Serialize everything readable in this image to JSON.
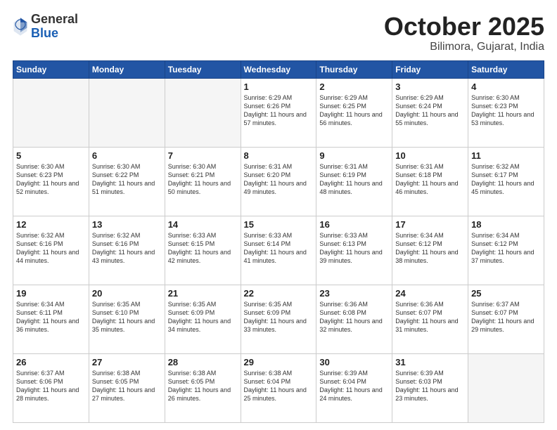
{
  "header": {
    "logo_general": "General",
    "logo_blue": "Blue",
    "month": "October 2025",
    "location": "Bilimora, Gujarat, India"
  },
  "weekdays": [
    "Sunday",
    "Monday",
    "Tuesday",
    "Wednesday",
    "Thursday",
    "Friday",
    "Saturday"
  ],
  "weeks": [
    [
      {
        "day": "",
        "info": ""
      },
      {
        "day": "",
        "info": ""
      },
      {
        "day": "",
        "info": ""
      },
      {
        "day": "1",
        "info": "Sunrise: 6:29 AM\nSunset: 6:26 PM\nDaylight: 11 hours\nand 57 minutes."
      },
      {
        "day": "2",
        "info": "Sunrise: 6:29 AM\nSunset: 6:25 PM\nDaylight: 11 hours\nand 56 minutes."
      },
      {
        "day": "3",
        "info": "Sunrise: 6:29 AM\nSunset: 6:24 PM\nDaylight: 11 hours\nand 55 minutes."
      },
      {
        "day": "4",
        "info": "Sunrise: 6:30 AM\nSunset: 6:23 PM\nDaylight: 11 hours\nand 53 minutes."
      }
    ],
    [
      {
        "day": "5",
        "info": "Sunrise: 6:30 AM\nSunset: 6:23 PM\nDaylight: 11 hours\nand 52 minutes."
      },
      {
        "day": "6",
        "info": "Sunrise: 6:30 AM\nSunset: 6:22 PM\nDaylight: 11 hours\nand 51 minutes."
      },
      {
        "day": "7",
        "info": "Sunrise: 6:30 AM\nSunset: 6:21 PM\nDaylight: 11 hours\nand 50 minutes."
      },
      {
        "day": "8",
        "info": "Sunrise: 6:31 AM\nSunset: 6:20 PM\nDaylight: 11 hours\nand 49 minutes."
      },
      {
        "day": "9",
        "info": "Sunrise: 6:31 AM\nSunset: 6:19 PM\nDaylight: 11 hours\nand 48 minutes."
      },
      {
        "day": "10",
        "info": "Sunrise: 6:31 AM\nSunset: 6:18 PM\nDaylight: 11 hours\nand 46 minutes."
      },
      {
        "day": "11",
        "info": "Sunrise: 6:32 AM\nSunset: 6:17 PM\nDaylight: 11 hours\nand 45 minutes."
      }
    ],
    [
      {
        "day": "12",
        "info": "Sunrise: 6:32 AM\nSunset: 6:16 PM\nDaylight: 11 hours\nand 44 minutes."
      },
      {
        "day": "13",
        "info": "Sunrise: 6:32 AM\nSunset: 6:16 PM\nDaylight: 11 hours\nand 43 minutes."
      },
      {
        "day": "14",
        "info": "Sunrise: 6:33 AM\nSunset: 6:15 PM\nDaylight: 11 hours\nand 42 minutes."
      },
      {
        "day": "15",
        "info": "Sunrise: 6:33 AM\nSunset: 6:14 PM\nDaylight: 11 hours\nand 41 minutes."
      },
      {
        "day": "16",
        "info": "Sunrise: 6:33 AM\nSunset: 6:13 PM\nDaylight: 11 hours\nand 39 minutes."
      },
      {
        "day": "17",
        "info": "Sunrise: 6:34 AM\nSunset: 6:12 PM\nDaylight: 11 hours\nand 38 minutes."
      },
      {
        "day": "18",
        "info": "Sunrise: 6:34 AM\nSunset: 6:12 PM\nDaylight: 11 hours\nand 37 minutes."
      }
    ],
    [
      {
        "day": "19",
        "info": "Sunrise: 6:34 AM\nSunset: 6:11 PM\nDaylight: 11 hours\nand 36 minutes."
      },
      {
        "day": "20",
        "info": "Sunrise: 6:35 AM\nSunset: 6:10 PM\nDaylight: 11 hours\nand 35 minutes."
      },
      {
        "day": "21",
        "info": "Sunrise: 6:35 AM\nSunset: 6:09 PM\nDaylight: 11 hours\nand 34 minutes."
      },
      {
        "day": "22",
        "info": "Sunrise: 6:35 AM\nSunset: 6:09 PM\nDaylight: 11 hours\nand 33 minutes."
      },
      {
        "day": "23",
        "info": "Sunrise: 6:36 AM\nSunset: 6:08 PM\nDaylight: 11 hours\nand 32 minutes."
      },
      {
        "day": "24",
        "info": "Sunrise: 6:36 AM\nSunset: 6:07 PM\nDaylight: 11 hours\nand 31 minutes."
      },
      {
        "day": "25",
        "info": "Sunrise: 6:37 AM\nSunset: 6:07 PM\nDaylight: 11 hours\nand 29 minutes."
      }
    ],
    [
      {
        "day": "26",
        "info": "Sunrise: 6:37 AM\nSunset: 6:06 PM\nDaylight: 11 hours\nand 28 minutes."
      },
      {
        "day": "27",
        "info": "Sunrise: 6:38 AM\nSunset: 6:05 PM\nDaylight: 11 hours\nand 27 minutes."
      },
      {
        "day": "28",
        "info": "Sunrise: 6:38 AM\nSunset: 6:05 PM\nDaylight: 11 hours\nand 26 minutes."
      },
      {
        "day": "29",
        "info": "Sunrise: 6:38 AM\nSunset: 6:04 PM\nDaylight: 11 hours\nand 25 minutes."
      },
      {
        "day": "30",
        "info": "Sunrise: 6:39 AM\nSunset: 6:04 PM\nDaylight: 11 hours\nand 24 minutes."
      },
      {
        "day": "31",
        "info": "Sunrise: 6:39 AM\nSunset: 6:03 PM\nDaylight: 11 hours\nand 23 minutes."
      },
      {
        "day": "",
        "info": ""
      }
    ]
  ]
}
